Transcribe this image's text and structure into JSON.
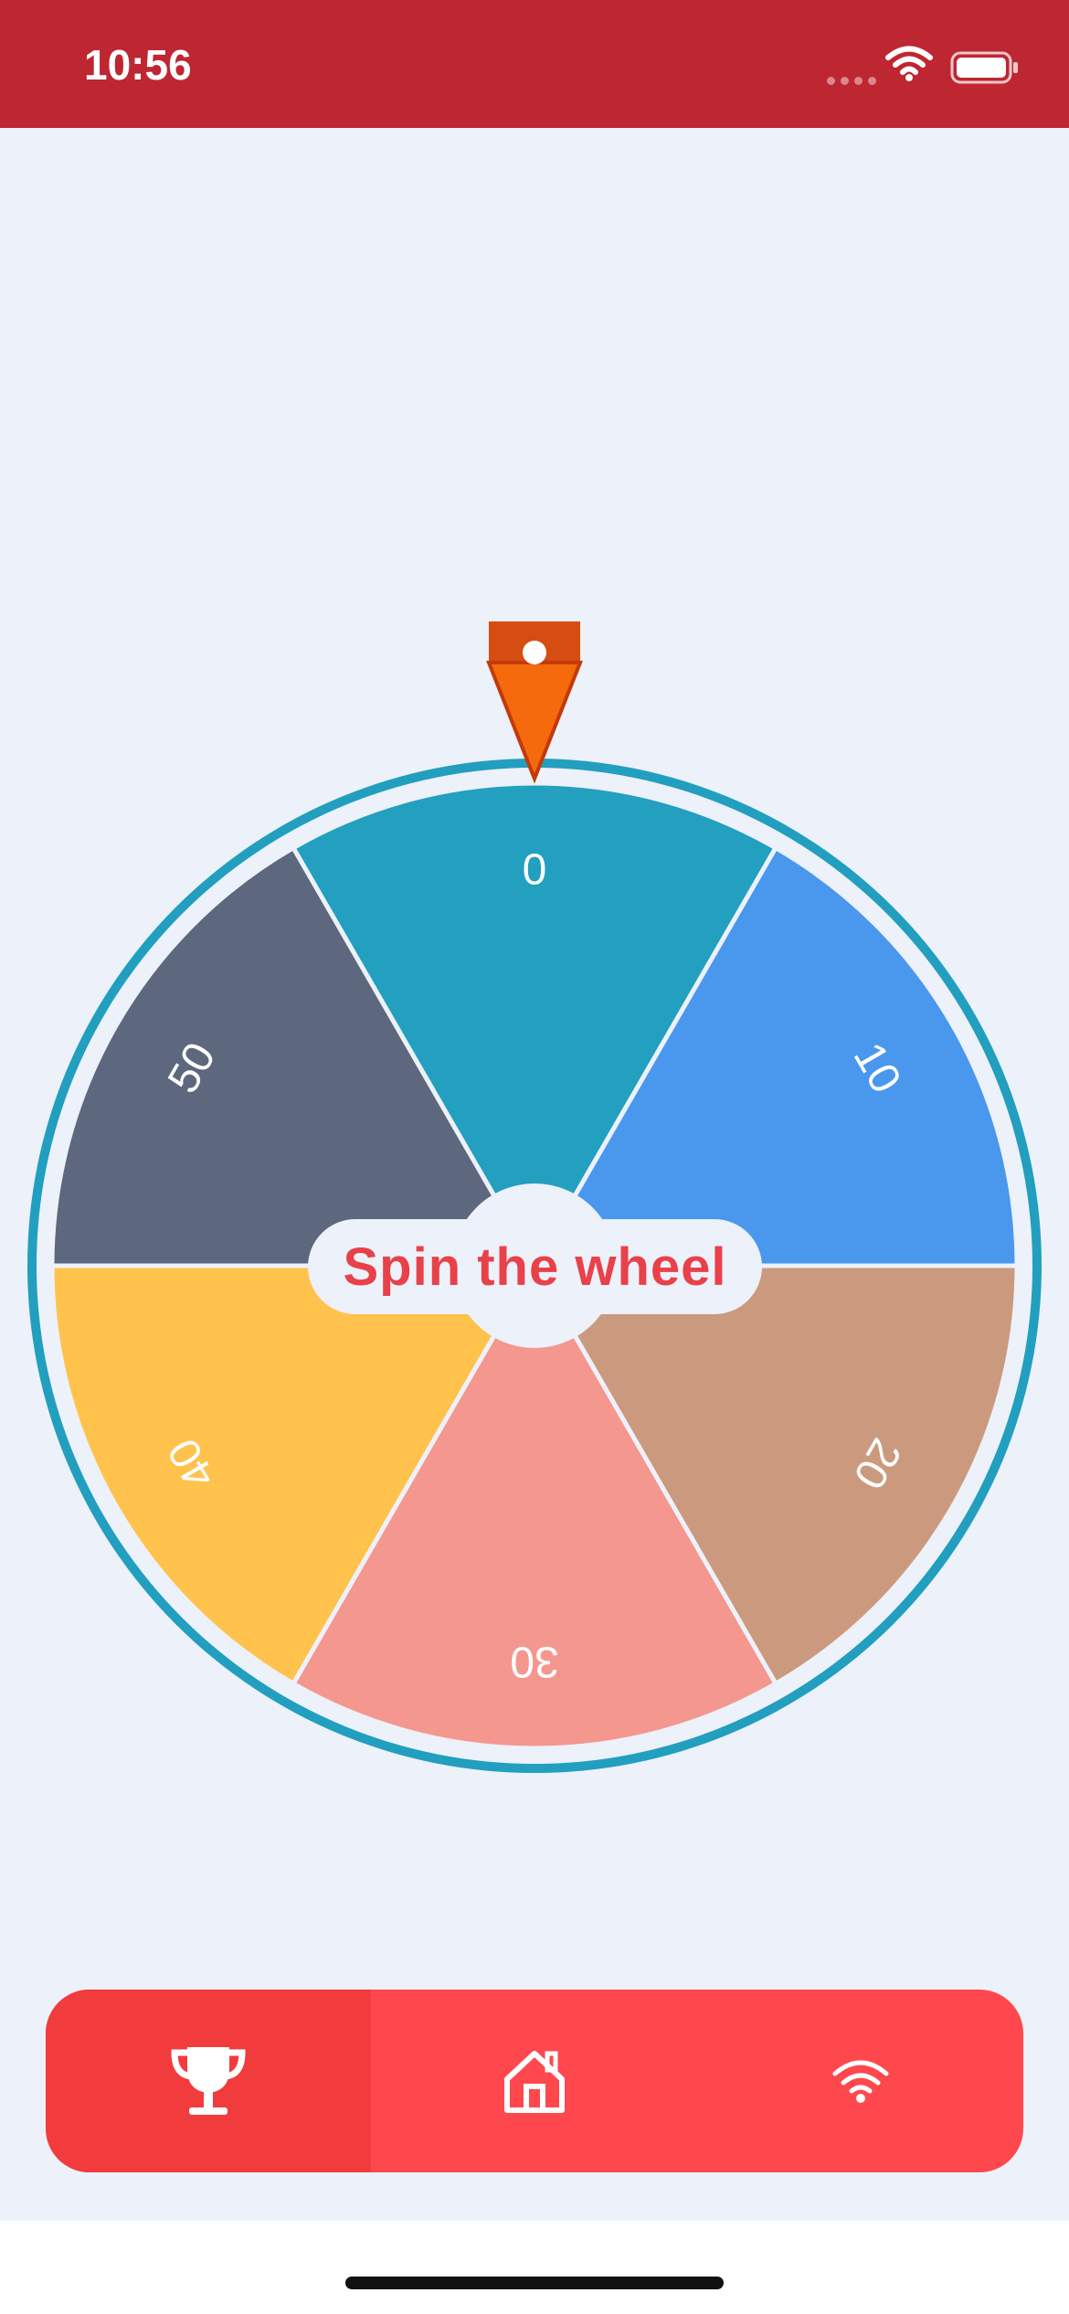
{
  "status_bar": {
    "time": "10:56",
    "background": "#be2631",
    "icons": [
      "signal-dots-icon",
      "wifi-icon",
      "battery-icon"
    ]
  },
  "wheel": {
    "border_color": "#229fbf",
    "segments": [
      {
        "label": "0",
        "color": "#239fc0"
      },
      {
        "label": "10",
        "color": "#4a97ee"
      },
      {
        "label": "20",
        "color": "#cb9a7e"
      },
      {
        "label": "30",
        "color": "#f4978f"
      },
      {
        "label": "40",
        "color": "#ffc24c"
      },
      {
        "label": "50",
        "color": "#5d677d"
      }
    ],
    "pointer_icon": "pointer-icon",
    "pointer_color": "#f46a0d"
  },
  "spin_button": {
    "label": "Spin the wheel",
    "color": "#e8414a"
  },
  "bottom_nav": {
    "background": "#fe484d",
    "active_background": "#f23b3c",
    "items": [
      {
        "icon": "trophy-icon",
        "active": true
      },
      {
        "icon": "home-icon",
        "active": false
      },
      {
        "icon": "wifi-icon",
        "active": false
      }
    ]
  }
}
